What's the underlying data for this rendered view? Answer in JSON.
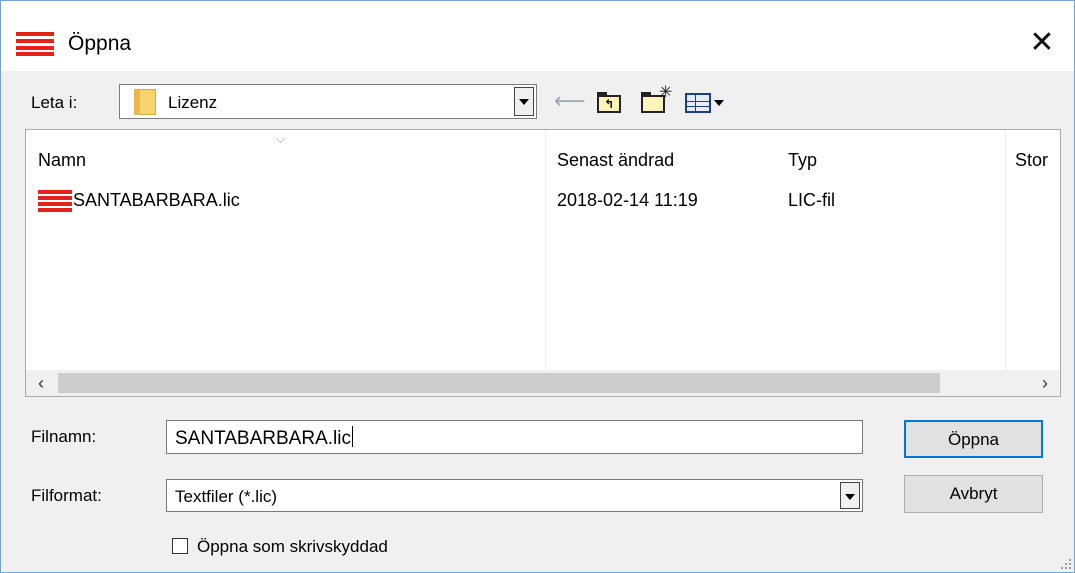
{
  "window": {
    "title": "Öppna"
  },
  "lookin": {
    "label": "Leta i:",
    "value": "Lizenz"
  },
  "columns": [
    "Namn",
    "Senast ändrad",
    "Typ",
    "Stor"
  ],
  "files": [
    {
      "name": "SANTABARBARA.lic",
      "modified": "2018-02-14 11:19",
      "type": "LIC-fil"
    }
  ],
  "filename": {
    "label": "Filnamn:",
    "value": "SANTABARBARA.lic"
  },
  "fileformat": {
    "label": "Filformat:",
    "value": "Textfiler (*.lic)"
  },
  "buttons": {
    "open": "Öppna",
    "cancel": "Avbryt"
  },
  "readonly_checkbox": {
    "label": "Öppna som skrivskyddad",
    "checked": false
  },
  "colors": {
    "accent": "#0078d7",
    "brand_red": "#e2231a"
  }
}
